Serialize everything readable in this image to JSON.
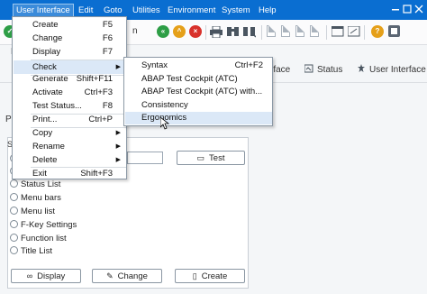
{
  "menubar": {
    "items": [
      {
        "label": "User Interface"
      },
      {
        "label": "Edit"
      },
      {
        "label": "Goto"
      },
      {
        "label": "Utilities"
      },
      {
        "label": "Environment"
      },
      {
        "label": "System"
      },
      {
        "label": "Help"
      }
    ]
  },
  "app_toolbar": {
    "partial_label": "rface",
    "status_label": "Status",
    "user_interface_label": "User Interface"
  },
  "left": {
    "label": "Pro",
    "panel_header": "S"
  },
  "dropdown": {
    "items": [
      {
        "label": "Create",
        "shortcut": "F5"
      },
      {
        "label": "Change",
        "shortcut": "F6"
      },
      {
        "label": "Display",
        "shortcut": "F7"
      },
      {
        "label": "Check",
        "shortcut": "",
        "arrow": "▶"
      },
      {
        "label": "Generate",
        "shortcut": "Shift+F11"
      },
      {
        "label": "Activate",
        "shortcut": "Ctrl+F3"
      },
      {
        "label": "Test Status...",
        "shortcut": "F8"
      },
      {
        "label": "Print...",
        "shortcut": "Ctrl+P"
      },
      {
        "label": "Copy",
        "shortcut": "",
        "arrow": "▶"
      },
      {
        "label": "Rename",
        "shortcut": "",
        "arrow": "▶"
      },
      {
        "label": "Delete",
        "shortcut": "",
        "arrow": "▶"
      },
      {
        "label": "Exit",
        "shortcut": "Shift+F3"
      }
    ]
  },
  "submenu": {
    "items": [
      {
        "label": "Syntax",
        "shortcut": "Ctrl+F2"
      },
      {
        "label": "ABAP Test Cockpit (ATC)",
        "shortcut": ""
      },
      {
        "label": "ABAP Test Cockpit (ATC) with...",
        "shortcut": ""
      },
      {
        "label": "Consistency",
        "shortcut": ""
      },
      {
        "label": "Ergonomics",
        "shortcut": ""
      }
    ]
  },
  "radios": [
    {
      "label": "Status List"
    },
    {
      "label": "Menu bars"
    },
    {
      "label": "Menu list"
    },
    {
      "label": "F-Key Settings"
    },
    {
      "label": "Function list"
    },
    {
      "label": "Title List"
    }
  ],
  "buttons": {
    "test": "Test",
    "display": "Display",
    "change": "Change",
    "create": "Create"
  },
  "colors": {
    "menubar": "#0a6ed1",
    "highlight": "#dbe8f7",
    "green": "#2e9e46",
    "orange": "#e5a01a",
    "red": "#d8322c"
  }
}
